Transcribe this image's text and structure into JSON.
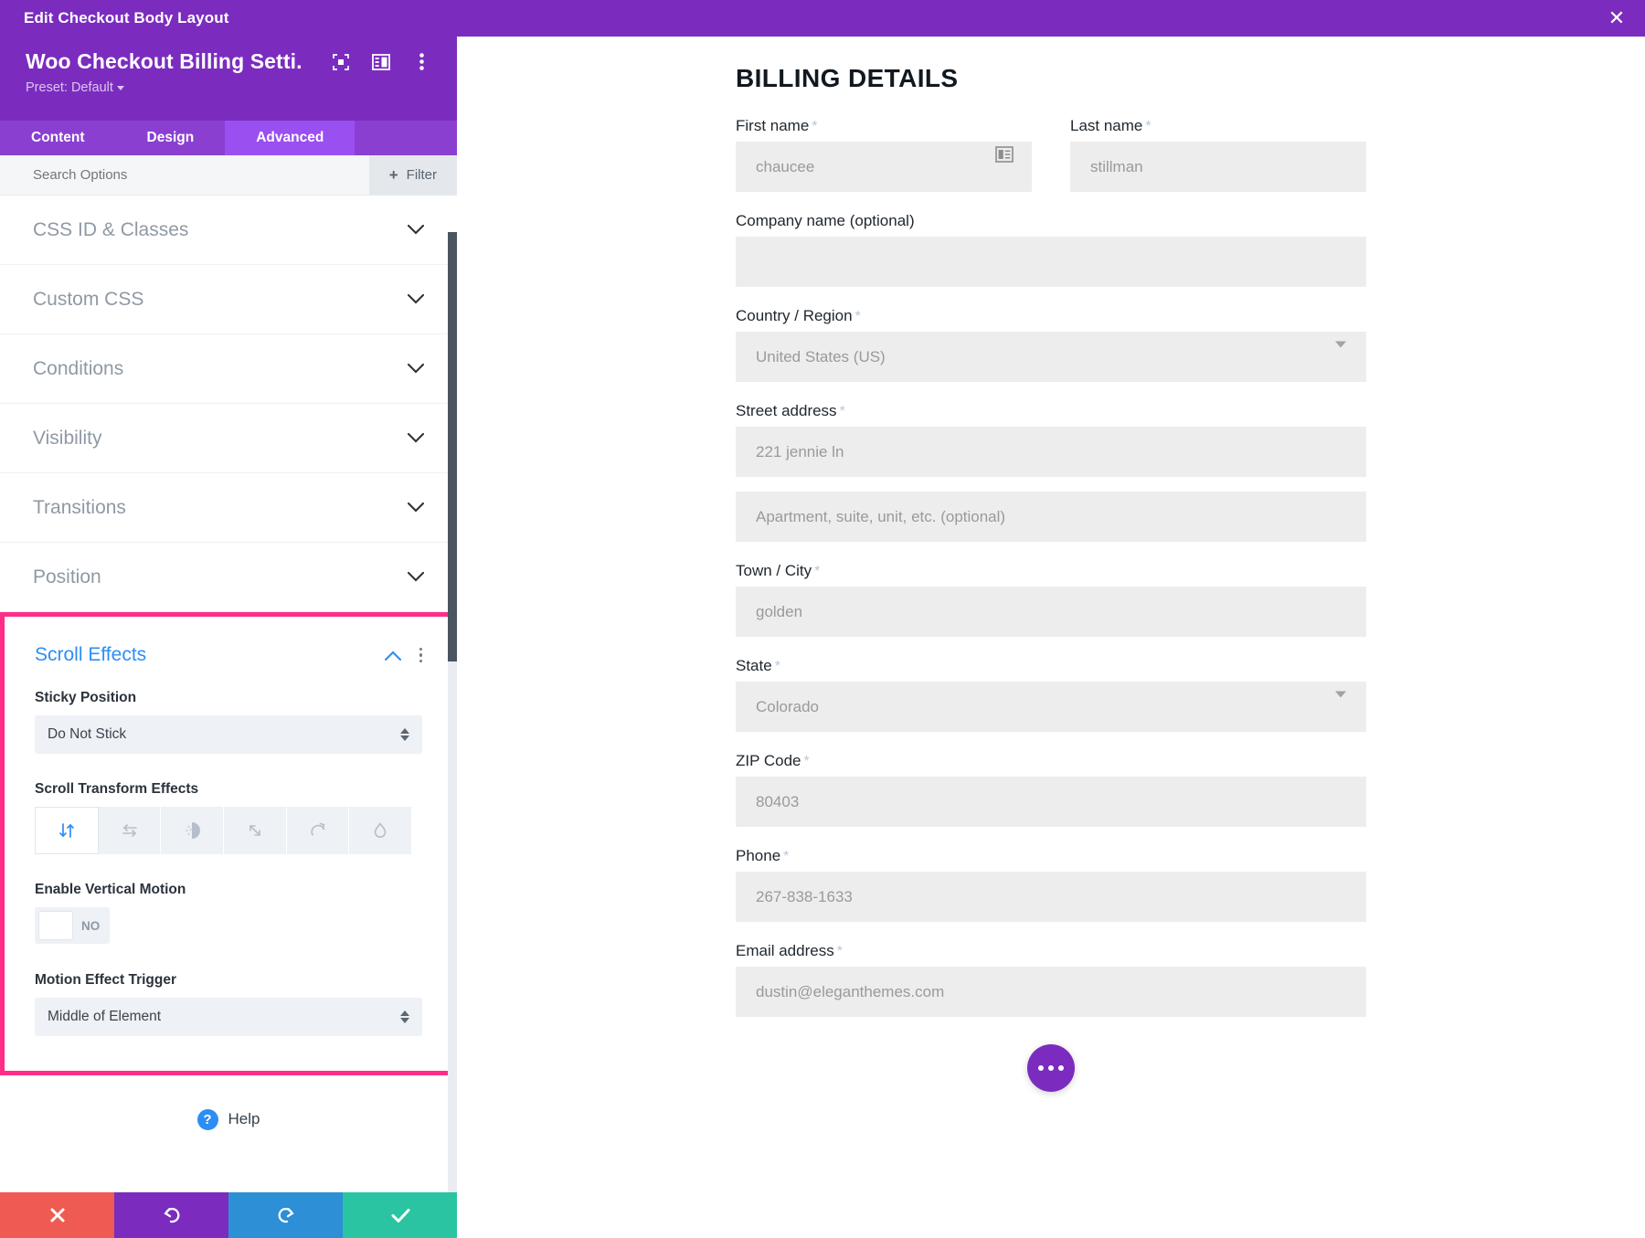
{
  "window": {
    "title": "Edit Checkout Body Layout",
    "close_icon": "close-icon"
  },
  "panel": {
    "module_title": "Woo Checkout Billing Setti...",
    "preset_label": "Preset: Default",
    "header_icons": [
      "focus-icon",
      "layout-panel-icon",
      "more-vertical-icon"
    ],
    "tabs": [
      {
        "label": "Content",
        "active": false
      },
      {
        "label": "Design",
        "active": false
      },
      {
        "label": "Advanced",
        "active": true
      }
    ],
    "search_placeholder": "Search Options",
    "filter_label": "Filter",
    "sections": [
      {
        "label": "CSS ID & Classes",
        "expanded": false
      },
      {
        "label": "Custom CSS",
        "expanded": false
      },
      {
        "label": "Conditions",
        "expanded": false
      },
      {
        "label": "Visibility",
        "expanded": false
      },
      {
        "label": "Transitions",
        "expanded": false
      },
      {
        "label": "Position",
        "expanded": false
      }
    ],
    "scroll_effects": {
      "title": "Scroll Effects",
      "highlight_color": "#ff2d87",
      "accent_color": "#2c8ef4",
      "sticky_position": {
        "label": "Sticky Position",
        "value": "Do Not Stick"
      },
      "scroll_transform": {
        "label": "Scroll Transform Effects",
        "options": [
          {
            "name": "vertical-motion-icon",
            "active": true
          },
          {
            "name": "horizontal-motion-icon",
            "active": false
          },
          {
            "name": "fade-in-out-icon",
            "active": false
          },
          {
            "name": "scaling-up-down-icon",
            "active": false
          },
          {
            "name": "rotating-icon",
            "active": false
          },
          {
            "name": "blur-icon",
            "active": false
          }
        ]
      },
      "enable_vertical_motion": {
        "label": "Enable Vertical Motion",
        "value": "NO"
      },
      "motion_effect_trigger": {
        "label": "Motion Effect Trigger",
        "value": "Middle of Element"
      }
    },
    "help_label": "Help",
    "actions": [
      {
        "name": "cancel-button",
        "icon": "x-icon",
        "color": "#ef5a52"
      },
      {
        "name": "undo-button",
        "icon": "undo-icon",
        "color": "#7b2cbf"
      },
      {
        "name": "redo-button",
        "icon": "redo-icon",
        "color": "#2d8fd5"
      },
      {
        "name": "save-button",
        "icon": "check-icon",
        "color": "#2bc4a2"
      }
    ]
  },
  "preview": {
    "heading": "BILLING DETAILS",
    "fields": {
      "first_name": {
        "label": "First name",
        "required": true,
        "placeholder": "chaucee"
      },
      "last_name": {
        "label": "Last name",
        "required": true,
        "placeholder": "stillman"
      },
      "company": {
        "label": "Company name (optional)",
        "required": false,
        "placeholder": ""
      },
      "country": {
        "label": "Country / Region",
        "required": true,
        "placeholder": "United States (US)"
      },
      "street": {
        "label": "Street address",
        "required": true,
        "placeholder": "221 jennie ln"
      },
      "street2": {
        "label": "",
        "required": false,
        "placeholder": "Apartment, suite, unit, etc. (optional)"
      },
      "city": {
        "label": "Town / City",
        "required": true,
        "placeholder": "golden"
      },
      "state": {
        "label": "State",
        "required": true,
        "placeholder": "Colorado"
      },
      "zip": {
        "label": "ZIP Code",
        "required": true,
        "placeholder": "80403"
      },
      "phone": {
        "label": "Phone",
        "required": true,
        "placeholder": "267-838-1633"
      },
      "email": {
        "label": "Email address",
        "required": true,
        "placeholder": "dustin@eleganthemes.com"
      }
    },
    "fab": {
      "name": "more-options-fab",
      "icon": "ellipsis-icon"
    }
  }
}
